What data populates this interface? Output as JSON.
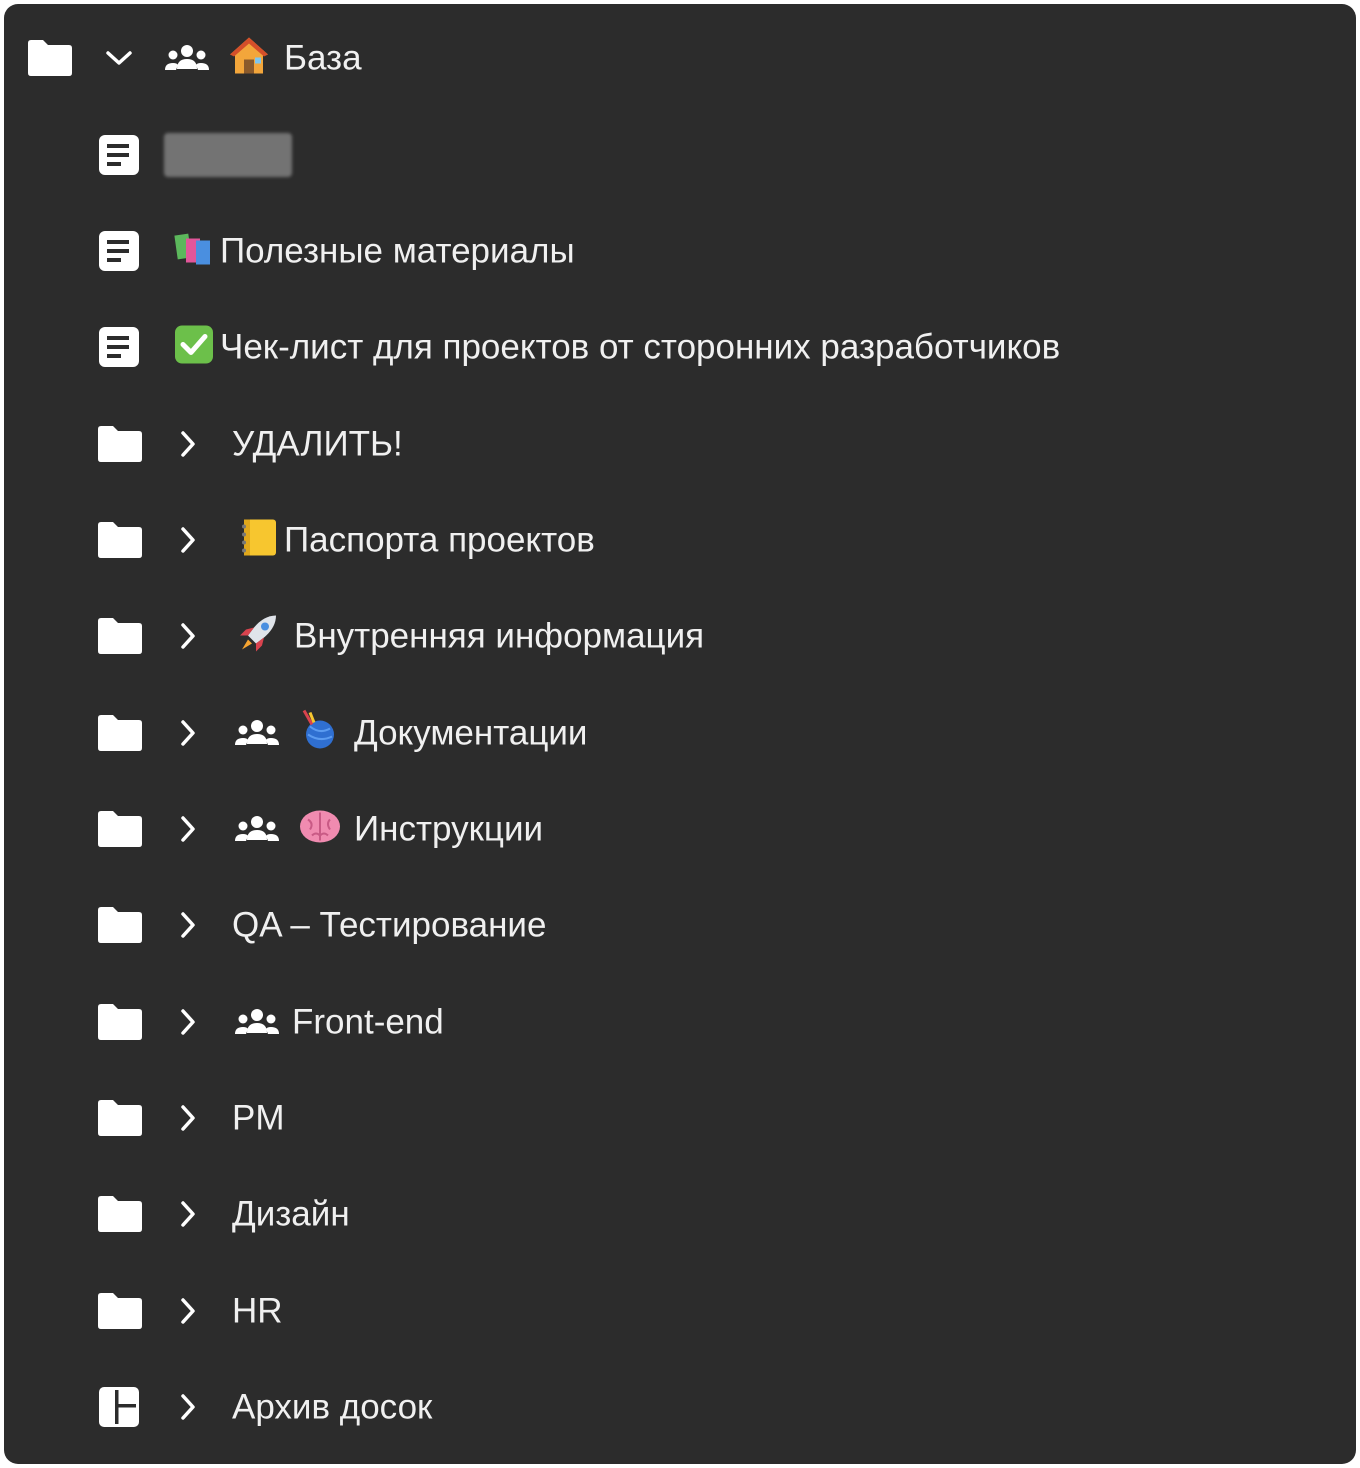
{
  "tree": {
    "root": {
      "label": "База",
      "icon": "folder-icon",
      "expanded": true,
      "shared": true,
      "emoji": "house-icon"
    },
    "items": [
      {
        "label": "",
        "type": "document",
        "redacted": true
      },
      {
        "label": "Полезные материалы",
        "type": "document",
        "emoji": "books-icon"
      },
      {
        "label": "Чек-лист для проектов от сторонних разработчиков",
        "type": "document",
        "emoji": "check-mark-button-icon"
      },
      {
        "label": "УДАЛИТЬ!",
        "type": "folder"
      },
      {
        "label": "Паспорта проектов",
        "type": "folder",
        "emoji": "notebook-icon"
      },
      {
        "label": "Внутренняя информация",
        "type": "folder",
        "emoji": "rocket-icon"
      },
      {
        "label": "Документации",
        "type": "folder",
        "shared": true,
        "emoji": "yarn-ball-icon"
      },
      {
        "label": "Инструкции",
        "type": "folder",
        "shared": true,
        "emoji": "brain-icon"
      },
      {
        "label": "QA – Тестирование",
        "type": "folder"
      },
      {
        "label": "Front-end",
        "type": "folder",
        "shared": true
      },
      {
        "label": "PM",
        "type": "folder"
      },
      {
        "label": "Дизайн",
        "type": "folder"
      },
      {
        "label": "HR",
        "type": "folder"
      },
      {
        "label": "Архив досок",
        "type": "board"
      }
    ]
  },
  "colors": {
    "background": "#2c2c2c",
    "text": "#f0f0f0",
    "icon": "#ffffff"
  }
}
